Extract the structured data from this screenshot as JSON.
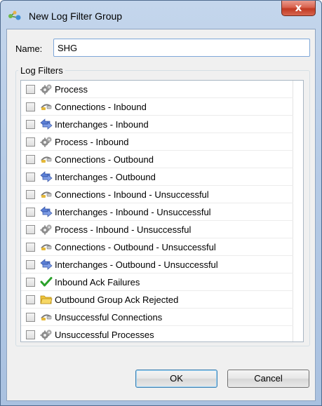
{
  "window": {
    "title": "New Log Filter Group",
    "close_label": "x"
  },
  "form": {
    "name_label": "Name:",
    "name_value": "SHG",
    "group_label": "Log Filters"
  },
  "filters": [
    {
      "label": "Process",
      "icon": "gears-icon",
      "checked": false
    },
    {
      "label": "Connections - Inbound",
      "icon": "connection-icon",
      "checked": false
    },
    {
      "label": "Interchanges - Inbound",
      "icon": "arrows-icon",
      "checked": false
    },
    {
      "label": "Process - Inbound",
      "icon": "gears-icon",
      "checked": false
    },
    {
      "label": "Connections - Outbound",
      "icon": "connection-icon",
      "checked": false
    },
    {
      "label": "Interchanges - Outbound",
      "icon": "arrows-icon",
      "checked": false
    },
    {
      "label": "Connections - Inbound - Unsuccessful",
      "icon": "connection-icon",
      "checked": false
    },
    {
      "label": "Interchanges - Inbound - Unsuccessful",
      "icon": "arrows-icon",
      "checked": false
    },
    {
      "label": "Process - Inbound - Unsuccessful",
      "icon": "gears-icon",
      "checked": false
    },
    {
      "label": "Connections - Outbound - Unsuccessful",
      "icon": "connection-icon",
      "checked": false
    },
    {
      "label": "Interchanges - Outbound - Unsuccessful",
      "icon": "arrows-icon",
      "checked": false
    },
    {
      "label": "Inbound Ack Failures",
      "icon": "checkmark-icon",
      "checked": false
    },
    {
      "label": "Outbound Group Ack Rejected",
      "icon": "folder-icon",
      "checked": false
    },
    {
      "label": "Unsuccessful Connections",
      "icon": "connection-icon",
      "checked": false
    },
    {
      "label": "Unsuccessful Processes",
      "icon": "gears-icon",
      "checked": false
    }
  ],
  "buttons": {
    "ok": "OK",
    "cancel": "Cancel"
  }
}
